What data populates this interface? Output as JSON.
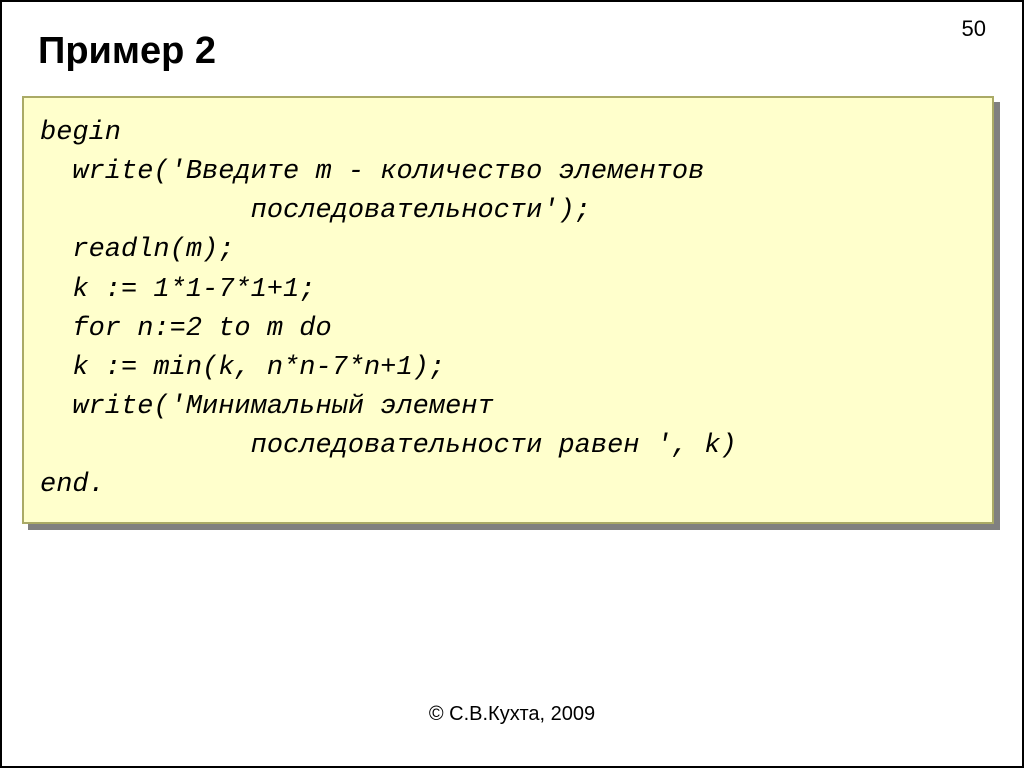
{
  "page": {
    "title": "Пример 2",
    "number": "50"
  },
  "code": {
    "l0": "begin",
    "l1": "  write('Введите m - количество элементов",
    "l2": "             последовательности');",
    "l3": "  readln(m);",
    "l4": "  k := 1*1-7*1+1;",
    "l5": "  for n:=2 to m do",
    "l6": "  k := min(k, n*n-7*n+1);",
    "l7": "  write('Минимальный элемент",
    "l8": "             последовательности равен ', k)",
    "l9": "end."
  },
  "footer": {
    "copyright": "© С.В.Кухта, 2009"
  }
}
